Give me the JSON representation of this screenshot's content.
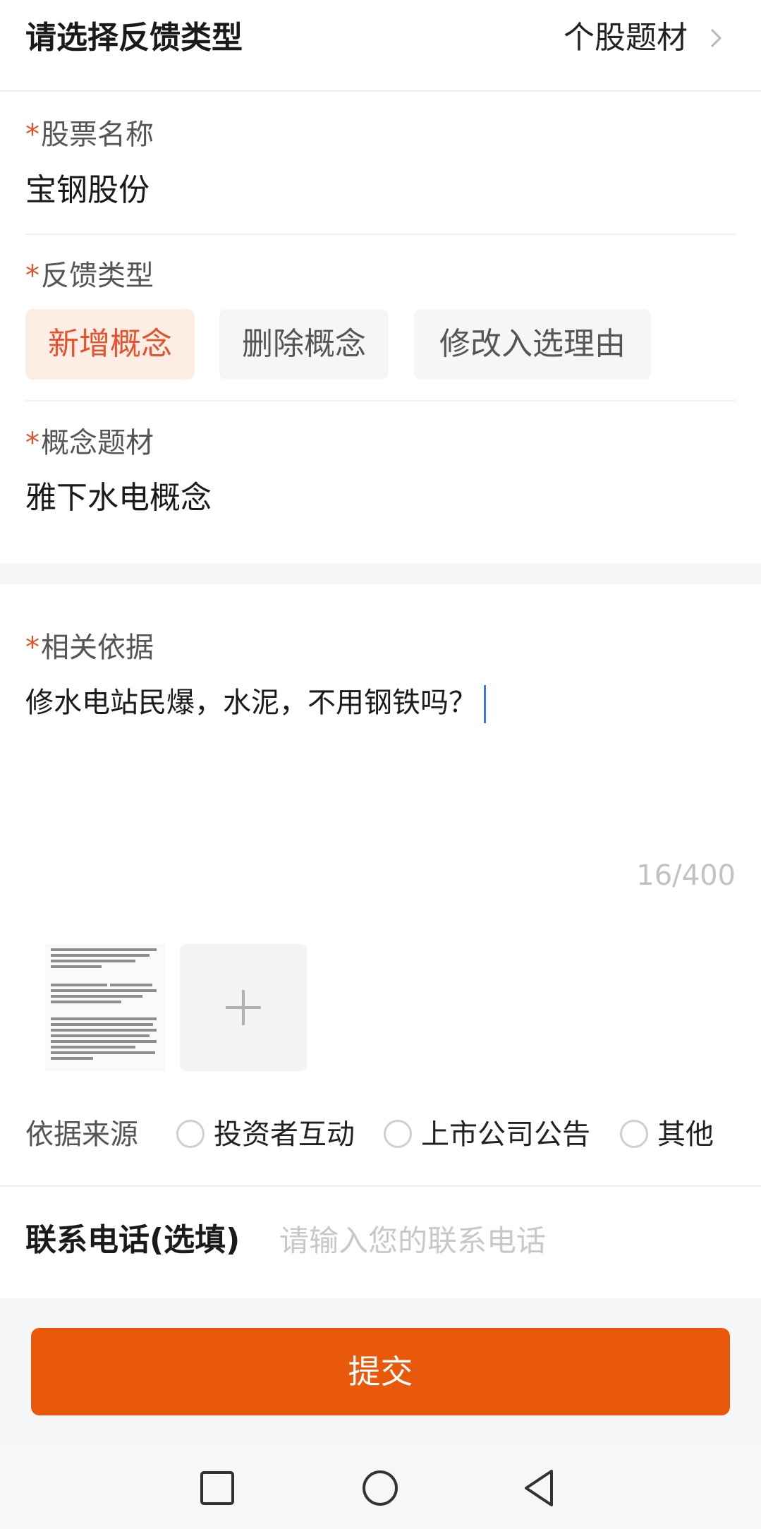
{
  "header": {
    "title": "请选择反馈类型",
    "selected_type": "个股题材",
    "chevron_icon": "chevron-right-icon"
  },
  "stock": {
    "required_mark": "*",
    "label": "股票名称",
    "value": "宝钢股份"
  },
  "feedback_type": {
    "required_mark": "*",
    "label": "反馈类型",
    "options": [
      {
        "label": "新增概念",
        "selected": true
      },
      {
        "label": "删除概念",
        "selected": false
      },
      {
        "label": "修改入选理由",
        "selected": false
      }
    ]
  },
  "concept": {
    "required_mark": "*",
    "label": "概念题材",
    "value": "雅下水电概念"
  },
  "basis": {
    "required_mark": "*",
    "label": "相关依据",
    "text": "修水电站民爆，水泥，不用钢铁吗？",
    "counter": "16/400"
  },
  "attachments": {
    "add_icon": "plus-icon"
  },
  "source": {
    "label": "依据来源",
    "options": [
      "投资者互动",
      "上市公司公告",
      "其他"
    ]
  },
  "phone": {
    "label": "联系电话(选填)",
    "placeholder": "请输入您的联系电话",
    "value": ""
  },
  "submit": {
    "label": "提交"
  },
  "nav": {
    "icons": [
      "recent-apps-icon",
      "home-icon",
      "back-icon"
    ]
  },
  "colors": {
    "accent": "#e8590c",
    "required": "#e5532d",
    "chip_active_bg": "#fdeee5",
    "chip_bg": "#f5f6f8",
    "caret": "#3b78e7"
  }
}
